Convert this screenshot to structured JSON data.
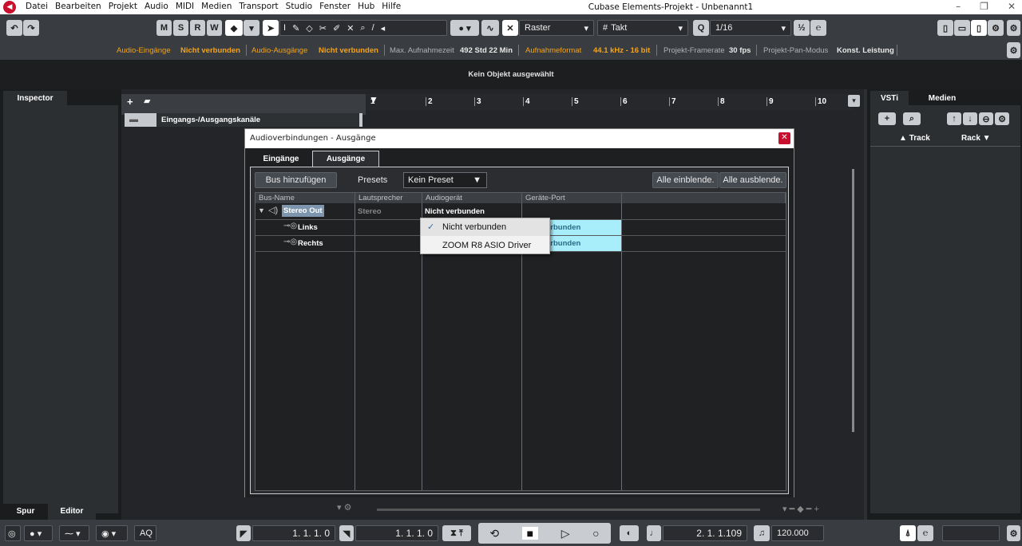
{
  "menu": [
    "Datei",
    "Bearbeiten",
    "Projekt",
    "Audio",
    "MIDI",
    "Medien",
    "Transport",
    "Studio",
    "Fenster",
    "Hub",
    "Hilfe"
  ],
  "app_title": "Cubase Elements-Projekt - Unbenannt1",
  "toolbar": {
    "m": "M",
    "s": "S",
    "r": "R",
    "w": "W",
    "snap_type": "Raster",
    "grid": "Takt",
    "quantize_label": "Q",
    "quantize": "1/16"
  },
  "status": {
    "audio_in_label": "Audio-Eingänge",
    "audio_in_value": "Nicht verbunden",
    "audio_out_label": "Audio-Ausgänge",
    "audio_out_value": "Nicht verbunden",
    "max_rec_label": "Max. Aufnahmezeit",
    "max_rec_value": "492 Std 22 Min",
    "rec_format_label": "Aufnahmeformat",
    "rec_format_value": "44.1 kHz - 16 bit",
    "framerate_label": "Projekt-Framerate",
    "framerate_value": "30 fps",
    "pan_label": "Projekt-Pan-Modus",
    "pan_value": "Konst. Leistung"
  },
  "info_line": "Kein Objekt ausgewählt",
  "inspector": {
    "tab": "Inspector",
    "bottom_tabs": [
      "Spur",
      "Editor"
    ]
  },
  "project": {
    "track_name": "Eingangs-/Ausgangskanäle",
    "ruler": [
      "1",
      "2",
      "3",
      "4",
      "5",
      "6",
      "7",
      "8",
      "9",
      "10"
    ]
  },
  "right_zone": {
    "tabs": [
      "VSTi",
      "Medien"
    ],
    "columns": [
      "Track",
      "Rack"
    ]
  },
  "dialog": {
    "title": "Audioverbindungen - Ausgänge",
    "tabs": [
      "Eingänge",
      "Ausgänge"
    ],
    "add_bus": "Bus hinzufügen",
    "presets_label": "Presets",
    "preset_value": "Kein Preset",
    "show_all": "Alle einblende.",
    "hide_all": "Alle ausblende.",
    "columns": [
      "Bus-Name",
      "Lautsprecher",
      "Audiogerät",
      "Geräte-Port"
    ],
    "rows": [
      {
        "name": "Stereo Out",
        "speaker": "Stereo",
        "device": "Nicht verbunden",
        "port": ""
      },
      {
        "name": "Links",
        "speaker": "",
        "device": "",
        "port": "erbunden"
      },
      {
        "name": "Rechts",
        "speaker": "",
        "device": "",
        "port": "erbunden"
      }
    ],
    "popup": [
      "Nicht verbunden",
      "ZOOM R8 ASIO Driver"
    ]
  },
  "transport": {
    "left_locator": "1. 1. 1.   0",
    "right_locator": "1. 1. 1.   0",
    "position": "2. 1. 1.109",
    "tempo": "120.000",
    "aq": "AQ"
  }
}
